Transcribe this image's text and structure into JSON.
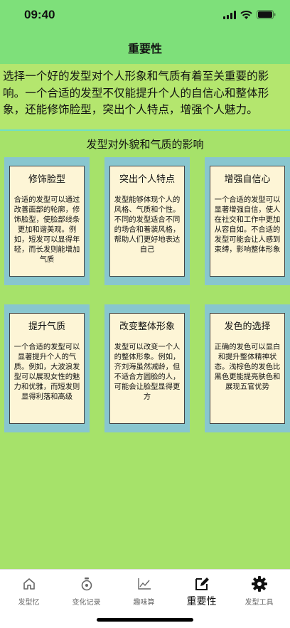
{
  "status": {
    "time": "09:40"
  },
  "nav": {
    "title": "重要性"
  },
  "intro": {
    "text": "选择一个好的发型对个人形象和气质有着至关重要的影响。一个合适的发型不仅能提升个人的自信心和整体形象，还能修饰脸型，突出个人特点，增强个人魅力。"
  },
  "section": {
    "title": "发型对外貌和气质的影响"
  },
  "cards": [
    {
      "title": "修饰脸型",
      "body": "合适的发型可以通过改善面部的轮廓，修饰脸型，使脸部线条更加和谐美观。例如，短发可以显得年轻，而长发则能增加气质"
    },
    {
      "title": "突出个人特点",
      "body": "发型能够体现个人的风格、气质和个性。不同的发型适合不同的场合和着装风格，帮助人们更好地表达自己"
    },
    {
      "title": "增强自信心",
      "body": "一个合适的发型可以显著增强自信，使人在社交和工作中更加从容自如。不合适的发型可能会让人感到束缚，影响整体形象"
    },
    {
      "title": "提升气质",
      "body": "一个合适的发型可以显著提升个人的气质。例如，大波浪发型可以展现女性的魅力和优雅，而短发则显得利落和高级"
    },
    {
      "title": "改变整体形象",
      "body": "发型可以改变一个人的整体形象。例如，齐刘海虽然减龄，但不适合方圆脸的人，可能会让脸型显得更方"
    },
    {
      "title": "发色的选择",
      "body": "正确的发色可以显白和提升整体精神状态。浅棕色的发色比黑色更能提亮肤色和展现五官优势"
    }
  ],
  "tabs": [
    {
      "label": "发型忆",
      "icon": "home-icon"
    },
    {
      "label": "变化记录",
      "icon": "stopwatch-icon"
    },
    {
      "label": "趣味算",
      "icon": "chart-line-icon"
    },
    {
      "label": "重要性",
      "icon": "edit-icon",
      "active": true
    },
    {
      "label": "发型工具",
      "icon": "gear-icon"
    }
  ]
}
